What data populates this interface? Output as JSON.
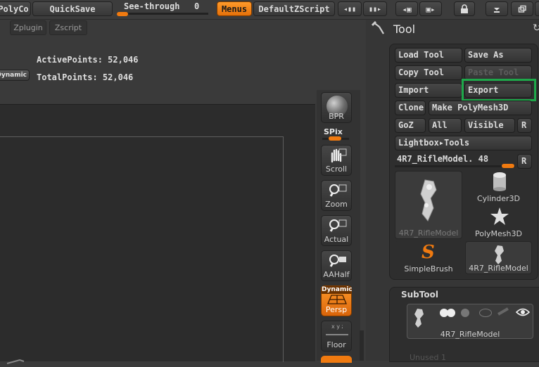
{
  "topbar": {
    "polycount_label": "PolyCo",
    "quicksave_label": "QuickSave",
    "seethrough_label": "See-through",
    "seethrough_value": "0",
    "menus_label": "Menus",
    "defaultzscript_label": "DefaultZScript"
  },
  "secondbar": {
    "zplugin_label": "Zplugin",
    "zscript_label": "Zscript"
  },
  "stats": {
    "active_points": "ActivePoints: 52,046",
    "total_points": "TotalPoints: 52,046",
    "dynamic_label": "Dynamic"
  },
  "shelf": {
    "bpr_label": "BPR",
    "spix_label": "SPix",
    "scroll_label": "Scroll",
    "zoom_label": "Zoom",
    "actual_label": "Actual",
    "aahalf_label": "AAHalf",
    "dynamic_label": "Dynamic",
    "persp_label": "Persp",
    "floor_label": "Floor"
  },
  "tool_panel": {
    "title": "Tool",
    "buttons": {
      "load_tool": "Load Tool",
      "save_as": "Save As",
      "copy_tool": "Copy Tool",
      "paste_tool": "Paste Tool",
      "import": "Import",
      "export": "Export",
      "clone": "Clone",
      "make_polymesh": "Make PolyMesh3D",
      "goz": "GoZ",
      "all": "All",
      "visible": "Visible",
      "r": "R",
      "lightbox_tools": "Lightbox▸Tools"
    },
    "current_tool_slider": "4R7_RifleModel. 48",
    "thumbnails": [
      {
        "label": "4R7_RifleModel"
      },
      {
        "label": "Cylinder3D"
      },
      {
        "label": "PolyMesh3D"
      },
      {
        "label": "SimpleBrush"
      },
      {
        "label": "4R7_RifleModel"
      }
    ]
  },
  "subtool": {
    "title": "SubTool",
    "item_label": "4R7_RifleModel",
    "unused_label": "Unused 1"
  },
  "colors": {
    "accent_orange": "#f07a10",
    "highlight_green": "#1ea84a"
  }
}
